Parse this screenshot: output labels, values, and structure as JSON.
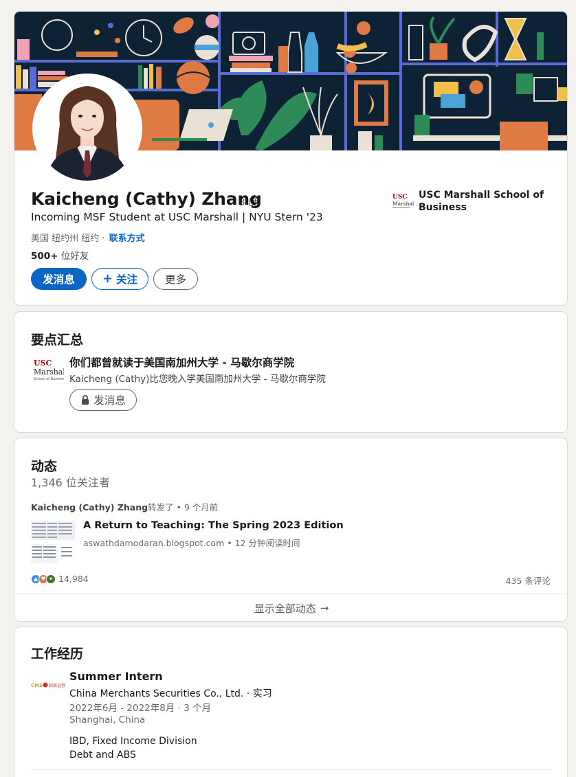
{
  "profile": {
    "name": "Kaicheng (Cathy) Zhang",
    "degree": "· 3 度",
    "headline": "Incoming MSF Student at USC Marshall | NYU Stern '23",
    "location": "美国 纽约州 纽约 ·",
    "contact_link": "联系方式",
    "connections_count": "500+",
    "connections_label": " 位好友",
    "message_button": "发消息",
    "follow_button": "关注",
    "more_button": "更多",
    "school_name": "USC Marshall School of Business",
    "school_logo_text": "USC Marshall"
  },
  "highlights": {
    "title": "要点汇总",
    "item_title": "你们都曾就读于美国南加州大学 - 马歇尔商学院",
    "item_subtitle": "Kaicheng (Cathy)比您晚入学美国南加州大学 - 马歇尔商学院",
    "message_button": "发消息"
  },
  "activity": {
    "title": "动态",
    "followers": "1,346 位关注者",
    "repost_author": "Kaicheng (Cathy) Zhang",
    "repost_action": "转发了 • 9 个月前",
    "post_title": "A Return to Teaching: The Spring 2023 Edition",
    "post_source": "aswathdamodaran.blogspot.com • 12 分钟阅读时间",
    "reaction_count": "14,984",
    "comments": "435 条评论",
    "show_all": "显示全部动态",
    "show_all_arrow": "→"
  },
  "experience": {
    "title": "工作经历",
    "job_title": "Summer Intern",
    "company": "China Merchants Securities Co., Ltd. · 实习",
    "dates": "2022年6月 - 2022年8月 · 3 个月",
    "location": "Shanghai, China",
    "description_line1": "IBD, Fixed Income Division",
    "description_line2": "Debt and ABS",
    "logo_text": "CMS 招商证券"
  },
  "colors": {
    "primary": "#0a66c2",
    "banner_bg": "#0e2235",
    "usc_red": "#990000"
  },
  "icons": [
    "plus-icon",
    "lock-icon",
    "arrow-right-icon",
    "like-icon",
    "love-icon",
    "support-icon"
  ]
}
